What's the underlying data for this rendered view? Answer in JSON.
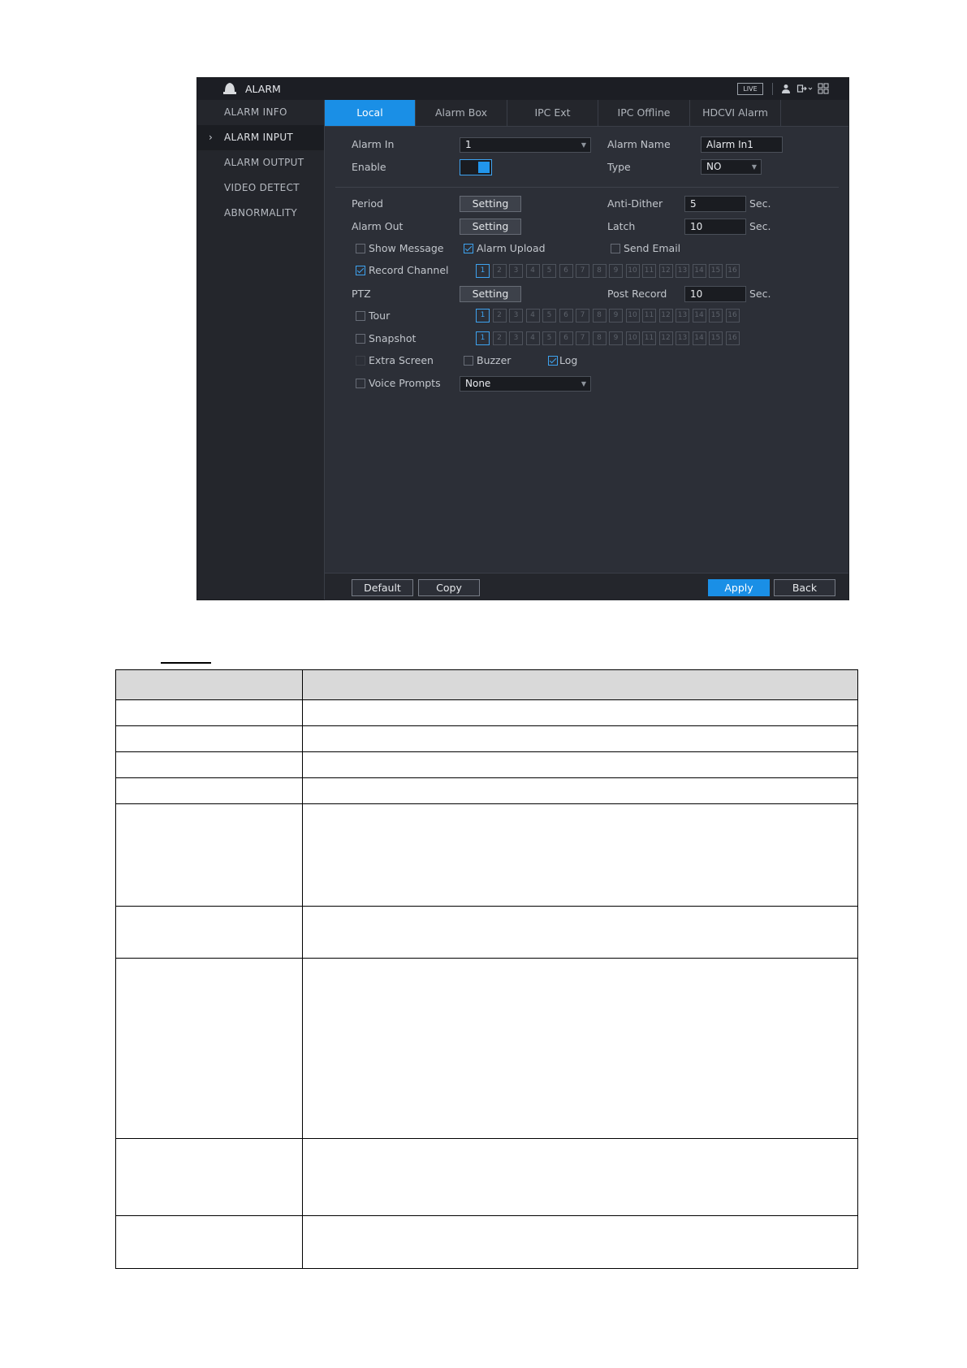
{
  "window": {
    "title": "ALARM",
    "live_badge": "LIVE"
  },
  "sidebar": {
    "items": [
      {
        "label": "ALARM INFO"
      },
      {
        "label": "ALARM INPUT",
        "active": true
      },
      {
        "label": "ALARM OUTPUT"
      },
      {
        "label": "VIDEO DETECT"
      },
      {
        "label": "ABNORMALITY"
      }
    ]
  },
  "tabs": [
    "Local",
    "Alarm Box",
    "IPC Ext",
    "IPC Offline",
    "HDCVI Alarm"
  ],
  "form": {
    "alarm_in_label": "Alarm In",
    "alarm_in_value": "1",
    "alarm_name_label": "Alarm Name",
    "alarm_name_value": "Alarm In1",
    "enable_label": "Enable",
    "enable_on": true,
    "type_label": "Type",
    "type_value": "NO",
    "period_label": "Period",
    "setting_label": "Setting",
    "anti_dither_label": "Anti-Dither",
    "anti_dither_value": "5",
    "sec_unit": "Sec.",
    "alarm_out_label": "Alarm Out",
    "latch_label": "Latch",
    "latch_value": "10",
    "show_message_label": "Show Message",
    "alarm_upload_label": "Alarm Upload",
    "send_email_label": "Send Email",
    "record_channel_label": "Record Channel",
    "ptz_label": "PTZ",
    "post_record_label": "Post Record",
    "post_record_value": "10",
    "tour_label": "Tour",
    "snapshot_label": "Snapshot",
    "extra_screen_label": "Extra Screen",
    "buzzer_label": "Buzzer",
    "log_label": "Log",
    "voice_prompts_label": "Voice Prompts",
    "voice_prompts_value": "None",
    "channels": [
      "1",
      "2",
      "3",
      "4",
      "5",
      "6",
      "7",
      "8",
      "9",
      "10",
      "11",
      "12",
      "13",
      "14",
      "15",
      "16"
    ]
  },
  "footer": {
    "default_label": "Default",
    "copy_label": "Copy",
    "apply_label": "Apply",
    "back_label": "Back"
  },
  "colors": {
    "accent": "#1a8fe6",
    "panel": "#2c2f37",
    "sidebar": "#24262c"
  }
}
